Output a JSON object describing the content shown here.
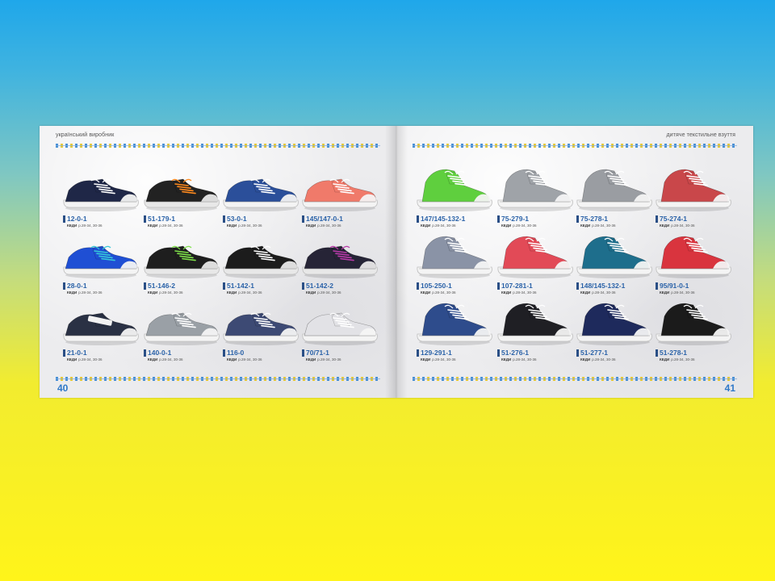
{
  "header": {
    "left": "український виробник",
    "right": "дитяче текстильне взуття"
  },
  "pages": {
    "left_number": "40",
    "right_number": "41"
  },
  "kind_label": "КЕДИ",
  "sizes_label": "р.28-34, 30-36",
  "left_items": [
    {
      "code": "12-0-1",
      "upper": "#1f2747",
      "sole": "#f4f4f4",
      "lace": "#ffffff",
      "style": "low"
    },
    {
      "code": "51-179-1",
      "upper": "#222222",
      "sole": "#e8e8e8",
      "lace": "#ff8a1e",
      "style": "low"
    },
    {
      "code": "53-0-1",
      "upper": "#2b4f9a",
      "sole": "#f4f4f4",
      "lace": "#ffffff",
      "style": "low"
    },
    {
      "code": "145/147-0-1",
      "upper": "#f07a6a",
      "sole": "#f4f4f4",
      "lace": "#ffffff",
      "style": "low"
    },
    {
      "code": "28-0-1",
      "upper": "#1f4fd4",
      "sole": "#f4f4f4",
      "lace": "#35c8d8",
      "style": "low"
    },
    {
      "code": "51-146-2",
      "upper": "#1e1e1e",
      "sole": "#e8e8e8",
      "lace": "#7ee04a",
      "style": "low"
    },
    {
      "code": "51-142-1",
      "upper": "#1c1c1c",
      "sole": "#e8e8e8",
      "lace": "#ffffff",
      "style": "low"
    },
    {
      "code": "51-142-2",
      "upper": "#262436",
      "sole": "#e8e8e8",
      "lace": "#b83aa8",
      "style": "low"
    },
    {
      "code": "21-0-1",
      "upper": "#2a3144",
      "sole": "#f4f4f4",
      "lace": "#ffffff",
      "style": "strap"
    },
    {
      "code": "140-0-1",
      "upper": "#9aa0a6",
      "sole": "#f4f4f4",
      "lace": "#ffffff",
      "style": "low"
    },
    {
      "code": "116-0",
      "upper": "#3d4a74",
      "sole": "#f4f4f4",
      "lace": "#ffffff",
      "style": "low"
    },
    {
      "code": "70/71-1",
      "upper": "#e2e2e6",
      "sole": "#f4f4f4",
      "lace": "#ffffff",
      "style": "low"
    }
  ],
  "right_items": [
    {
      "code": "147/145-132-1",
      "upper": "#5fcf3e",
      "sole": "#f4f4f4",
      "lace": "#ffffff",
      "style": "high"
    },
    {
      "code": "75-279-1",
      "upper": "#9fa3a8",
      "sole": "#f4f4f4",
      "lace": "#ffffff",
      "style": "high"
    },
    {
      "code": "75-278-1",
      "upper": "#9a9da2",
      "sole": "#f4f4f4",
      "lace": "#ffffff",
      "style": "high"
    },
    {
      "code": "75-274-1",
      "upper": "#c9474a",
      "sole": "#f4f4f4",
      "lace": "#ffffff",
      "style": "high"
    },
    {
      "code": "105-250-1",
      "upper": "#8a93a6",
      "sole": "#f4f4f4",
      "lace": "#ffffff",
      "style": "high"
    },
    {
      "code": "107-281-1",
      "upper": "#e24a57",
      "sole": "#f4f4f4",
      "lace": "#ffffff",
      "style": "high"
    },
    {
      "code": "148/145-132-1",
      "upper": "#1e6e8c",
      "sole": "#f4f4f4",
      "lace": "#ffffff",
      "style": "high"
    },
    {
      "code": "95/91-0-1",
      "upper": "#d9343e",
      "sole": "#f4f4f4",
      "lace": "#ffffff",
      "style": "high"
    },
    {
      "code": "129-291-1",
      "upper": "#2e4c8c",
      "sole": "#f4f4f4",
      "lace": "#ffffff",
      "style": "high"
    },
    {
      "code": "51-276-1",
      "upper": "#1f1f24",
      "sole": "#f4f4f4",
      "lace": "#ffffff",
      "style": "high"
    },
    {
      "code": "51-277-1",
      "upper": "#1e2a5c",
      "sole": "#f4f4f4",
      "lace": "#ffffff",
      "style": "high"
    },
    {
      "code": "51-278-1",
      "upper": "#1b1b1b",
      "sole": "#f4f4f4",
      "lace": "#ffffff",
      "style": "high"
    }
  ]
}
